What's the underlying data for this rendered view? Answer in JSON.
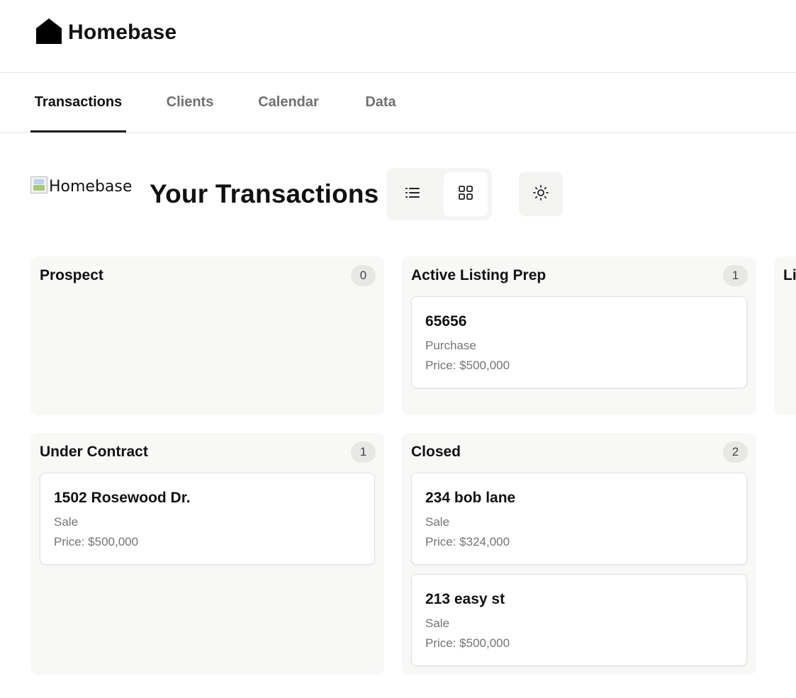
{
  "brand": {
    "name": "Homebase",
    "icon": "house-icon"
  },
  "tabs": [
    {
      "label": "Transactions",
      "active": true
    },
    {
      "label": "Clients",
      "active": false
    },
    {
      "label": "Calendar",
      "active": false
    },
    {
      "label": "Data",
      "active": false
    }
  ],
  "header": {
    "logo_alt": "Homebase",
    "title": "Your Transactions",
    "view_modes": [
      {
        "icon": "list-view-icon",
        "selected": false
      },
      {
        "icon": "grid-view-icon",
        "selected": true
      }
    ],
    "theme_icon": "sun-icon"
  },
  "columns": [
    {
      "title": "Prospect",
      "count": "0",
      "cards": []
    },
    {
      "title": "Active Listing Prep",
      "count": "1",
      "cards": [
        {
          "title": "65656",
          "type": "Purchase",
          "price": "Price: $500,000"
        }
      ]
    },
    {
      "title": "Live",
      "visible_label": "Li",
      "count": "",
      "cards": []
    },
    {
      "title": "Under Contract",
      "count": "1",
      "cards": [
        {
          "title": "1502 Rosewood Dr.",
          "type": "Sale",
          "price": "Price: $500,000"
        }
      ]
    },
    {
      "title": "Closed",
      "count": "2",
      "cards": [
        {
          "title": "234 bob lane",
          "type": "Sale",
          "price": "Price: $324,000"
        },
        {
          "title": "213 easy st",
          "type": "Sale",
          "price": "Price: $500,000"
        }
      ]
    }
  ],
  "colors": {
    "text": "#111111",
    "muted": "#747474",
    "tab_underline": "#1a1a2a",
    "column_bg": "#f8f8f7",
    "badge_bg": "#e7e7e6"
  }
}
